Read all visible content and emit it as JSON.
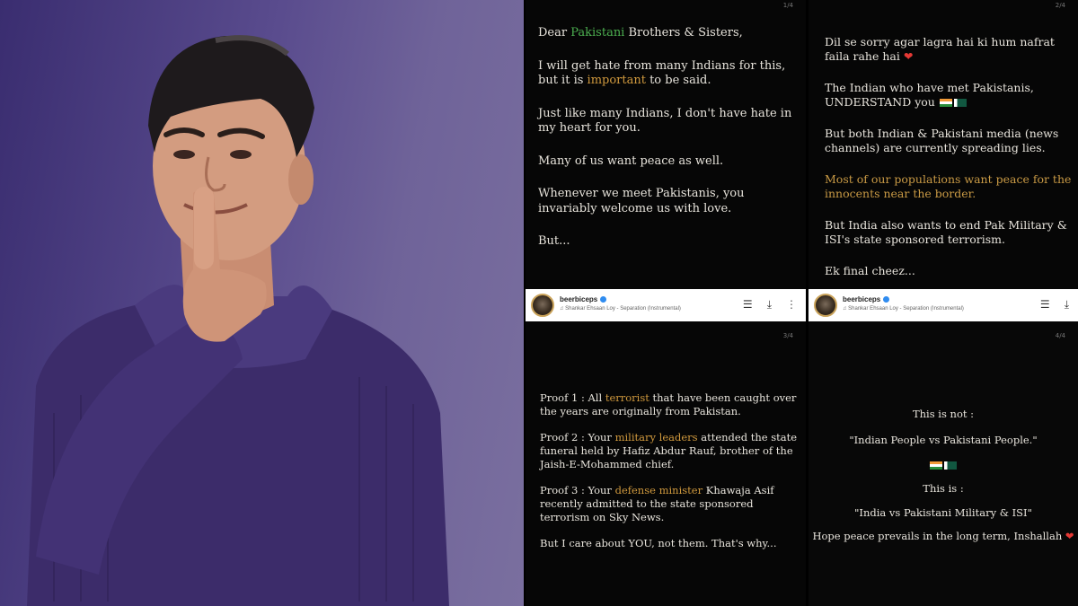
{
  "panel1": {
    "page": "1/4",
    "salutation_pre": "Dear ",
    "salutation_highlight": "Pakistani",
    "salutation_post": " Brothers & Sisters,",
    "para2_pre": "I will get hate from many Indians for this, but it is ",
    "para2_highlight": "important",
    "para2_post": " to be said.",
    "para3": "Just like many Indians, I don't have hate in my heart for you.",
    "para4": "Many of us want peace as well.",
    "para5": "Whenever we meet Pakistanis, you invariably welcome us with love.",
    "para6": "But..."
  },
  "panel2": {
    "page": "2/4",
    "para1": "Dil se sorry agar lagra hai ki hum nafrat faila rahe hai",
    "para2": "The Indian who have met Pakistanis, UNDERSTAND you",
    "para3": "But both Indian & Pakistani media (news channels) are currently spreading lies.",
    "para4": "Most of our populations want peace for the innocents near the border.",
    "para5": "But India also wants to end Pak Military & ISI's state sponsored terrorism.",
    "para6": "Ek final cheez..."
  },
  "panel3": {
    "page": "3/4",
    "proof1_pre": "Proof 1 : All ",
    "proof1_highlight": "terrorist",
    "proof1_post": " that have been caught over the years are originally from Pakistan.",
    "proof2_pre": "Proof 2 : Your ",
    "proof2_highlight": "military leaders",
    "proof2_post": " attended the state funeral held by Hafiz Abdur Rauf, brother of the Jaish-E-Mohammed chief.",
    "proof3_pre": "Proof 3 : Your ",
    "proof3_highlight": "defense minister",
    "proof3_post": " Khawaja Asif recently admitted to the state sponsored terrorism on Sky News.",
    "closing": "But I care about YOU, not them. That's why..."
  },
  "panel4": {
    "page": "4/4",
    "line1": "This is not :",
    "line2": "\"Indian People vs Pakistani People.\"",
    "line3": "This is :",
    "line4": "\"India vs Pakistani Military & ISI\"",
    "line5": "Hope peace prevails in the long term, Inshallah"
  },
  "profile_bar": {
    "username": "beerbiceps",
    "song": "Shankar Ehsaan Loy - Separation (Instrumental)"
  },
  "icons": {
    "heart": "red-heart-icon",
    "flags": "india-pakistan-flag-icons",
    "bar": [
      "playlist-icon",
      "download-icon",
      "more-options-icon"
    ]
  },
  "colors": {
    "highlight_green": "#4caf50",
    "highlight_gold": "#d19a3e",
    "background_purple": "#5a4c8e"
  }
}
